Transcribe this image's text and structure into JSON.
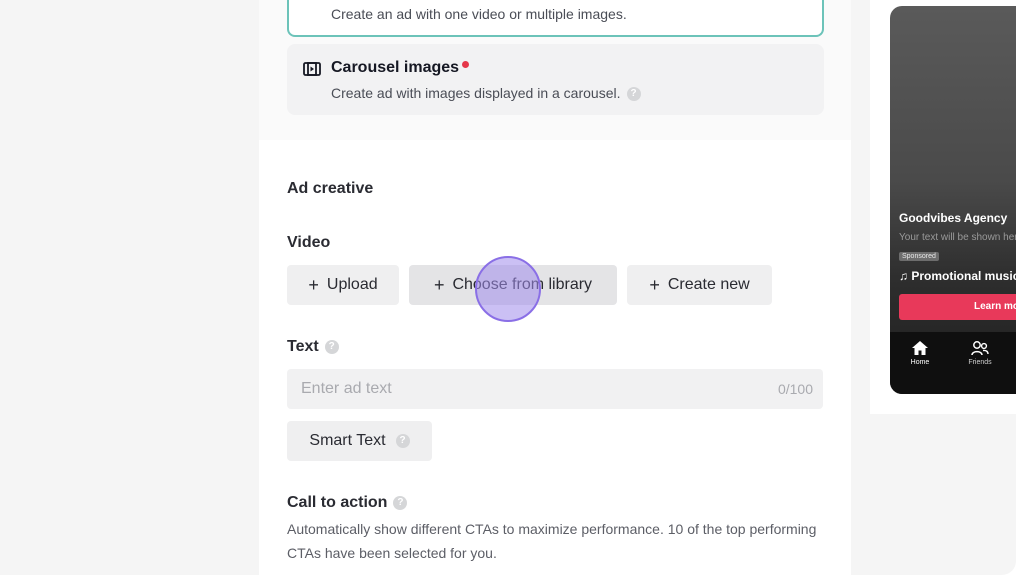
{
  "format_options": {
    "single": {
      "description": "Create an ad with one video or multiple images."
    },
    "carousel": {
      "title": "Carousel images",
      "icon": "carousel-icon",
      "description": "Create ad with images displayed in a carousel.",
      "dot_color": "#e5374a"
    }
  },
  "ad_creative": {
    "section_title": "Ad creative",
    "video": {
      "label": "Video",
      "upload_label": "Upload",
      "library_label": "Choose from library",
      "create_label": "Create new"
    },
    "text": {
      "label": "Text",
      "placeholder": "Enter ad text",
      "counter": "0/100",
      "smart_text_label": "Smart Text"
    },
    "cta": {
      "label": "Call to action",
      "description": "Automatically show different CTAs to maximize performance. 10 of the top performing CTAs have been selected for you."
    }
  },
  "preview": {
    "account_name": "Goodvibes Agency",
    "caption": "Your text will be shown here",
    "sponsored_label": "Sponsored",
    "music": "Promotional music",
    "cta_button": "Learn more",
    "tabs": [
      {
        "label": "Home",
        "icon": "home-icon"
      },
      {
        "label": "Friends",
        "icon": "friends-icon"
      }
    ]
  },
  "colors": {
    "selected_border": "#6cc3b9",
    "cta_button": "#e8395a"
  }
}
